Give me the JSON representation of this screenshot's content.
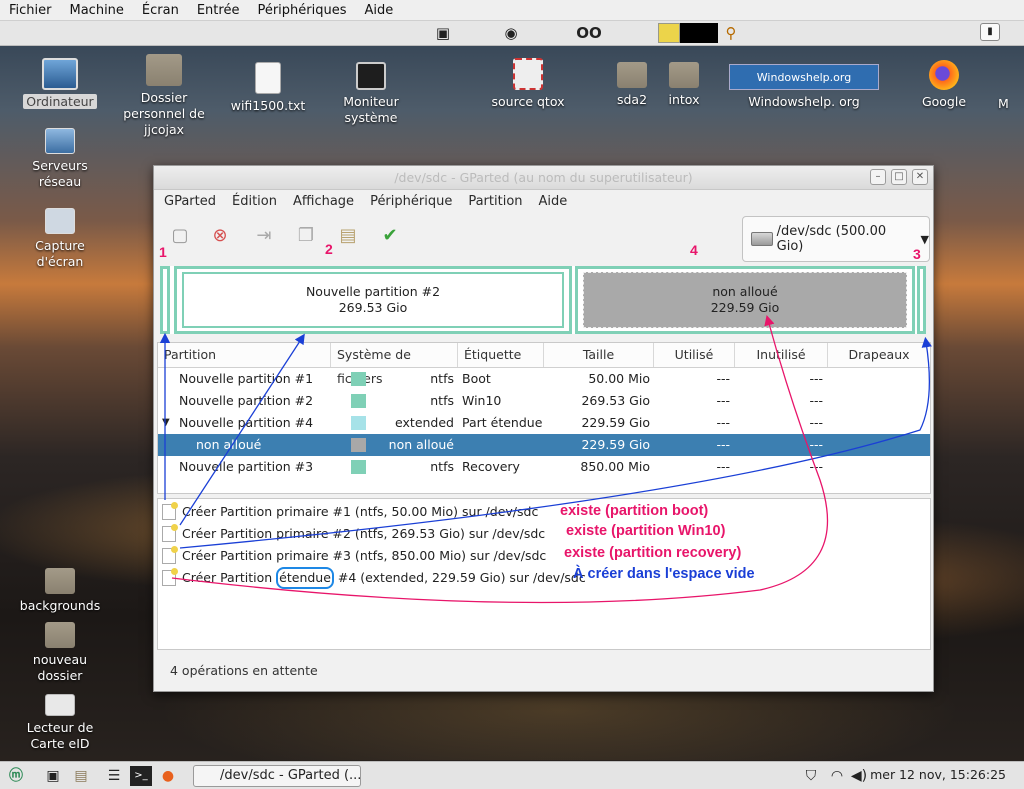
{
  "vm_menu": [
    "Fichier",
    "Machine",
    "Écran",
    "Entrée",
    "Périphériques",
    "Aide"
  ],
  "desktop": {
    "ordinateur": "Ordinateur",
    "dossier": "Dossier personnel de jjcojax",
    "wifi": "wifi1500.txt",
    "moniteur": "Moniteur système",
    "qtox": "source qtox",
    "sda2": "sda2",
    "intox": "intox",
    "windowshelp": "Windowshelp. org",
    "windowshelp_logo": "Windowshelp.org",
    "google": "Google",
    "m": "M",
    "serveurs": "Serveurs réseau",
    "capture": "Capture d'écran",
    "backgrounds": "backgrounds",
    "nouveau": "nouveau dossier",
    "lecteur": "Lecteur de Carte eID"
  },
  "window": {
    "title": "/dev/sdc - GParted (au nom du superutilisateur)",
    "menu": [
      "GParted",
      "Édition",
      "Affichage",
      "Périphérique",
      "Partition",
      "Aide"
    ],
    "device": "/dev/sdc  (500.00 Gio)",
    "graph": {
      "p2_name": "Nouvelle partition #2",
      "p2_size": "269.53 Gio",
      "un_name": "non alloué",
      "un_size": "229.59 Gio"
    },
    "columns": [
      "Partition",
      "Système de fichiers",
      "Étiquette",
      "Taille",
      "Utilisé",
      "Inutilisé",
      "Drapeaux"
    ],
    "rows": [
      {
        "partition": "Nouvelle partition #1",
        "fs": "ntfs",
        "label": "Boot",
        "size": "50.00 Mio",
        "used": "---",
        "unused": "---",
        "color": "#7fd0b6"
      },
      {
        "partition": "Nouvelle partition #2",
        "fs": "ntfs",
        "label": "Win10",
        "size": "269.53 Gio",
        "used": "---",
        "unused": "---",
        "color": "#7fd0b6"
      },
      {
        "partition": "Nouvelle partition #4",
        "fs": "extended",
        "label": "Part étendue",
        "size": "229.59 Gio",
        "used": "---",
        "unused": "---",
        "color": "#a6e2e8"
      },
      {
        "partition": "non alloué",
        "fs": "non alloué",
        "label": "",
        "size": "229.59 Gio",
        "used": "---",
        "unused": "---",
        "color": "#a8a8a8"
      },
      {
        "partition": "Nouvelle partition #3",
        "fs": "ntfs",
        "label": "Recovery",
        "size": "850.00 Mio",
        "used": "---",
        "unused": "---",
        "color": "#7fd0b6"
      }
    ],
    "operations": [
      "Créer Partition primaire #1 (ntfs, 50.00 Mio) sur /dev/sdc",
      "Créer Partition primaire #2 (ntfs, 269.53 Gio) sur /dev/sdc",
      "Créer Partition primaire #3 (ntfs, 850.00 Mio) sur /dev/sdc"
    ],
    "op4": {
      "a": "Créer Partition ",
      "b": "étendue",
      "c": " #4 (extended, 229.59 Gio) sur /dev/sdc"
    },
    "status": "4 opérations en attente"
  },
  "annotations": {
    "n1": "1",
    "n2": "2",
    "n3": "3",
    "n4": "4",
    "a1": "existe (partition boot)",
    "a2": "existe (partition Win10)",
    "a3": "existe (partition recovery)",
    "a4": "À créer dans l'espace vide"
  },
  "taskbar": {
    "window": "/dev/sdc - GParted (...",
    "clock": "mer 12 nov, 15:26:25"
  }
}
